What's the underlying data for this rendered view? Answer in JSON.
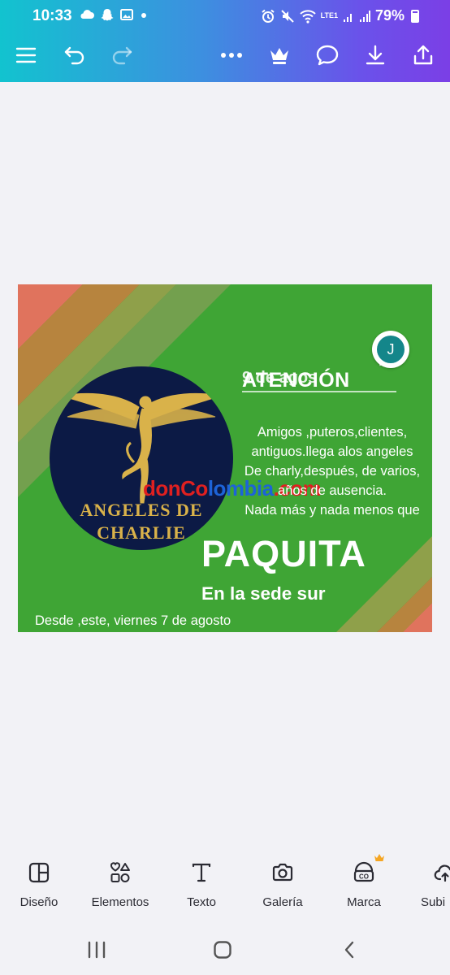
{
  "status_bar": {
    "time": "10:33",
    "battery": "79%",
    "network": "LTE1"
  },
  "toolbar": {
    "menu_icon": "hamburger-icon",
    "undo_icon": "undo-icon",
    "redo_icon": "redo-icon",
    "more_icon": "more-icon",
    "premium_icon": "crown-icon",
    "comment_icon": "comment-icon",
    "download_icon": "download-icon",
    "share_icon": "share-icon"
  },
  "design": {
    "logo": {
      "line1": "ANGELES DE",
      "line2": "CHARLIE"
    },
    "watermark": {
      "part1": "donCo",
      "part2": "lombia",
      "part3": ".com"
    },
    "scribble": "9 de agos",
    "heading": "ATENCIÓN",
    "body_lines": [
      "Amigos ,puteros,clientes,",
      "antiguos.llega alos angeles",
      "De charly,después, de varios,",
      "años de ausencia.",
      "Nada más y nada menos que"
    ],
    "name": "PAQUITA",
    "subtitle": "En la sede  sur",
    "footer": "Desde ,este, viernes 7 de agosto",
    "collaborator_initial": "J"
  },
  "bottom_bar": {
    "items": [
      {
        "label": "Diseño",
        "icon": "layout-icon"
      },
      {
        "label": "Elementos",
        "icon": "shapes-icon"
      },
      {
        "label": "Texto",
        "icon": "text-icon"
      },
      {
        "label": "Galería",
        "icon": "camera-icon"
      },
      {
        "label": "Marca",
        "icon": "brand-icon"
      },
      {
        "label": "Subi",
        "icon": "upload-cloud-icon"
      }
    ]
  },
  "colors": {
    "canvas_green": "#3fa535",
    "stripe_salmon": "#e0735d",
    "logo_navy": "#0c1a45",
    "logo_gold": "#d9b24a"
  }
}
